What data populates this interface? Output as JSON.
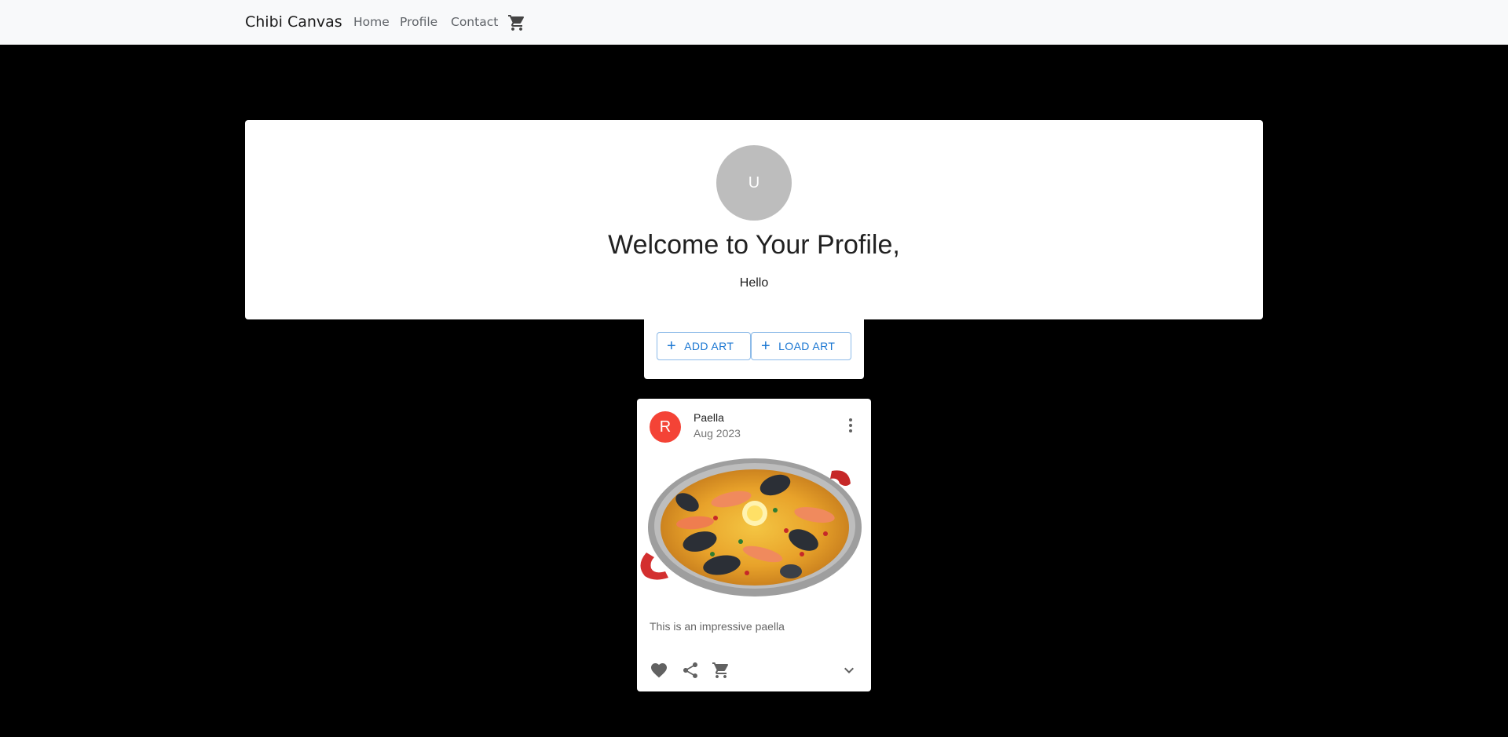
{
  "navbar": {
    "brand": "Chibi Canvas",
    "links": [
      "Home",
      "Profile",
      "Contact"
    ],
    "cart_icon": "shopping-cart-icon"
  },
  "profile": {
    "avatar_letter": "U",
    "welcome": "Welcome to Your Profile,",
    "greeting": "Hello"
  },
  "actions": {
    "add_label": "ADD ART",
    "load_label": "LOAD ART"
  },
  "art_card": {
    "avatar_letter": "R",
    "title": "Paella",
    "date": "Aug 2023",
    "description": "This is an impressive paella",
    "icons": [
      "more-vert-icon",
      "heart-icon",
      "share-icon",
      "cart-icon",
      "expand-more-icon"
    ]
  },
  "colors": {
    "accent": "#1976d2",
    "card_avatar": "#f44336",
    "profile_avatar": "#bdbdbd",
    "background": "#000000",
    "navbar": "#f8f9fa"
  }
}
